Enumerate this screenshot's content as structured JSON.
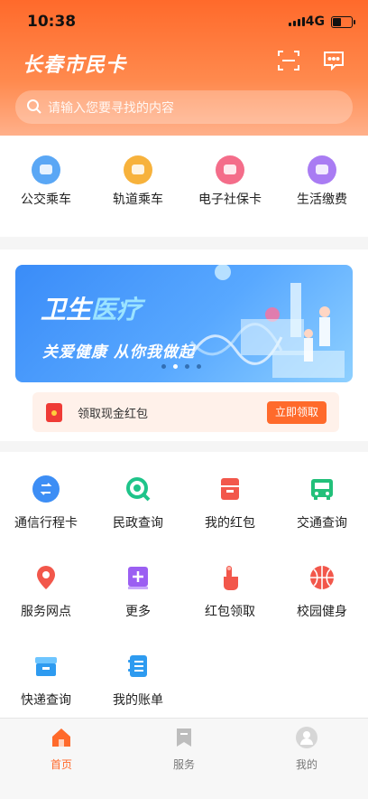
{
  "status": {
    "time": "10:38",
    "network": "4G"
  },
  "header": {
    "title": "长春市民卡",
    "search_placeholder": "请输入您要寻找的内容"
  },
  "quick_services": [
    {
      "label": "公交乘车",
      "icon": "bus-card-icon",
      "color": "#5aa7f5"
    },
    {
      "label": "轨道乘车",
      "icon": "metro-card-icon",
      "color": "#f7b23c"
    },
    {
      "label": "电子社保卡",
      "icon": "social-security-card-icon",
      "color": "#f46d8a"
    },
    {
      "label": "生活缴费",
      "icon": "wallet-icon",
      "color": "#a97cf3"
    }
  ],
  "banner": {
    "title_part1": "卫生",
    "title_part2": "医疗",
    "slogan": "关爱健康 从你我做起"
  },
  "red_packet_bar": {
    "text": "领取现金红包",
    "button": "立即领取"
  },
  "services": [
    {
      "label": "通信行程卡",
      "icon": "travel-card-icon"
    },
    {
      "label": "民政查询",
      "icon": "search-circle-icon"
    },
    {
      "label": "我的红包",
      "icon": "red-packet-icon"
    },
    {
      "label": "交通查询",
      "icon": "bus-icon"
    },
    {
      "label": "服务网点",
      "icon": "location-pin-icon"
    },
    {
      "label": "更多",
      "icon": "plus-square-icon"
    },
    {
      "label": "红包领取",
      "icon": "hand-tap-icon"
    },
    {
      "label": "校园健身",
      "icon": "basketball-icon"
    },
    {
      "label": "快递查询",
      "icon": "parcel-icon"
    },
    {
      "label": "我的账单",
      "icon": "bill-icon"
    }
  ],
  "tabs": [
    {
      "label": "首页",
      "icon": "home-icon",
      "active": true
    },
    {
      "label": "服务",
      "icon": "bookmark-icon",
      "active": false
    },
    {
      "label": "我的",
      "icon": "user-avatar-icon",
      "active": false
    }
  ],
  "colors": {
    "brand_orange": "#ff6a2b",
    "tab_active": "#ff6a2b"
  }
}
